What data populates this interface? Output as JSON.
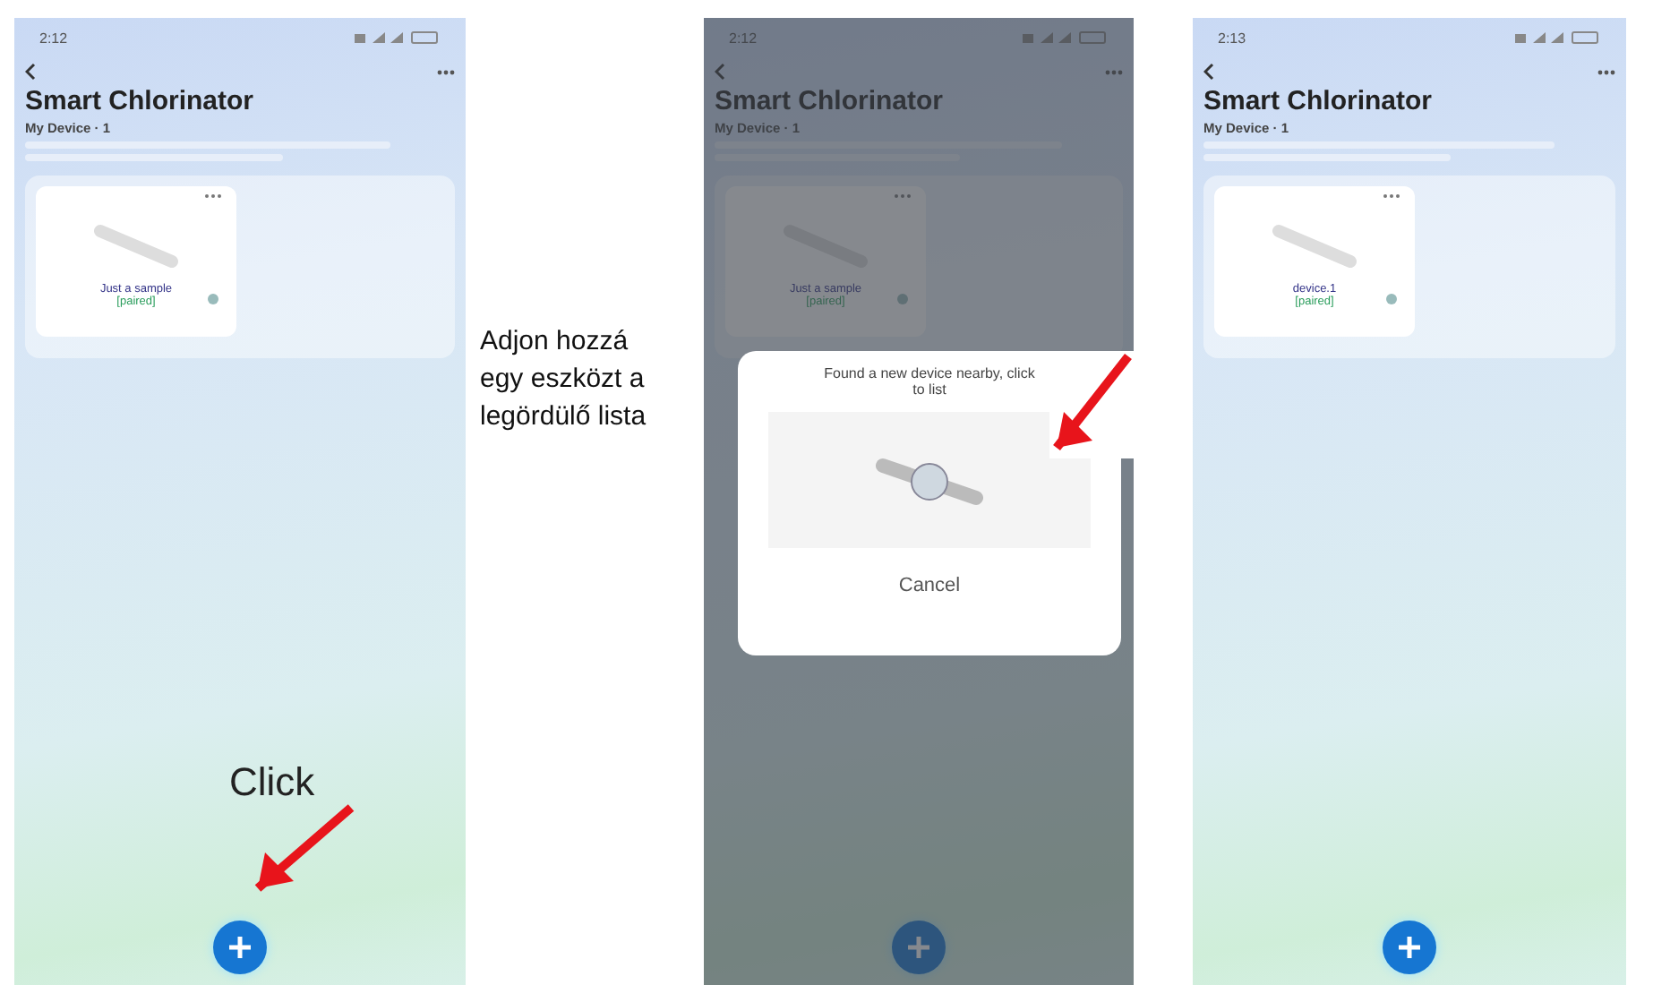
{
  "screens": [
    {
      "status_time": "2:12",
      "title": "Smart Chlorinator",
      "subtitle": "My Device · 1",
      "dimmed": false,
      "devices": [
        {
          "name": "Just a sample",
          "status": "[paired]"
        }
      ],
      "callout": "Click"
    },
    {
      "status_time": "2:12",
      "title": "Smart Chlorinator",
      "subtitle": "My Device · 1",
      "dimmed": true,
      "devices": [
        {
          "name": "Just a sample",
          "status": "[paired]"
        }
      ],
      "dialog": {
        "title_lines": [
          "Found a new device nearby, click",
          "to list"
        ],
        "button": "Cancel"
      }
    },
    {
      "status_time": "2:13",
      "title": "Smart Chlorinator",
      "subtitle": "My Device · 1",
      "dimmed": false,
      "devices": [
        {
          "name": "device.1",
          "status": "[paired]"
        }
      ]
    }
  ],
  "caption": "Adjon hozzá egy eszközt a legördülő lista"
}
